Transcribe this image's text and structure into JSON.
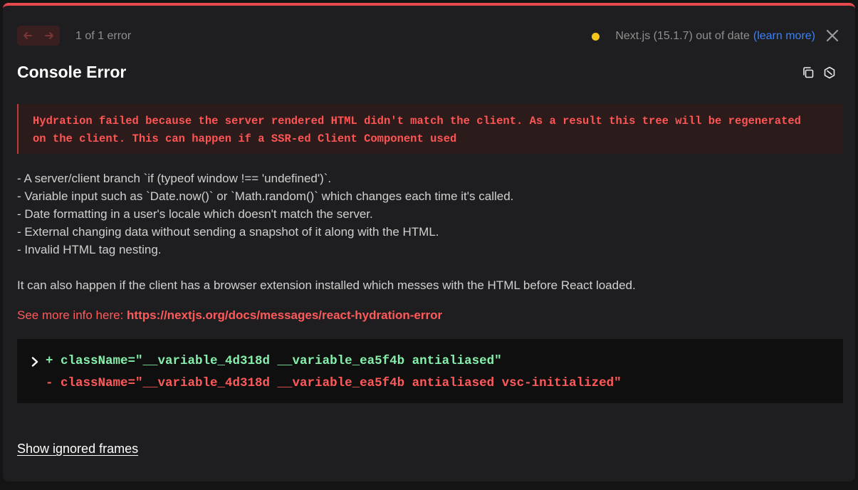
{
  "header": {
    "prev_icon": "arrow-left-icon",
    "next_icon": "arrow-right-icon",
    "error_count": "1 of 1 error",
    "version_text": "Next.js (15.1.7) out of date",
    "learn_more": "(learn more)",
    "status_color": "#f5c518"
  },
  "title": "Console Error",
  "actions": {
    "copy_icon": "copy-icon",
    "docs_icon": "hexagon-icon"
  },
  "error_message_line1": "Hydration failed because the server rendered HTML didn't match the client. As a result this tree will be regenerated",
  "error_message_line2": "on the client. This can happen if a SSR-ed Client Component used",
  "causes": [
    "- A server/client branch `if (typeof window !== 'undefined')`.",
    "- Variable input such as `Date.now()` or `Math.random()` which changes each time it's called.",
    "- Date formatting in a user's locale which doesn't match the server.",
    "- External changing data without sending a snapshot of it along with the HTML.",
    "- Invalid HTML tag nesting."
  ],
  "extension_note": "It can also happen if the client has a browser extension installed which messes with the HTML before React loaded.",
  "more_info_label": "See more info here: ",
  "more_info_url": "https://nextjs.org/docs/messages/react-hydration-error",
  "diff": {
    "added": "+ className=\"__variable_4d318d __variable_ea5f4b antialiased\"",
    "removed": "- className=\"__variable_4d318d __variable_ea5f4b antialiased vsc-initialized\""
  },
  "show_ignored_frames": "Show ignored frames",
  "colors": {
    "accent_red": "#e5484d",
    "error_text": "#ff5555",
    "link_blue": "#3b82f6",
    "diff_add": "#86efac"
  }
}
